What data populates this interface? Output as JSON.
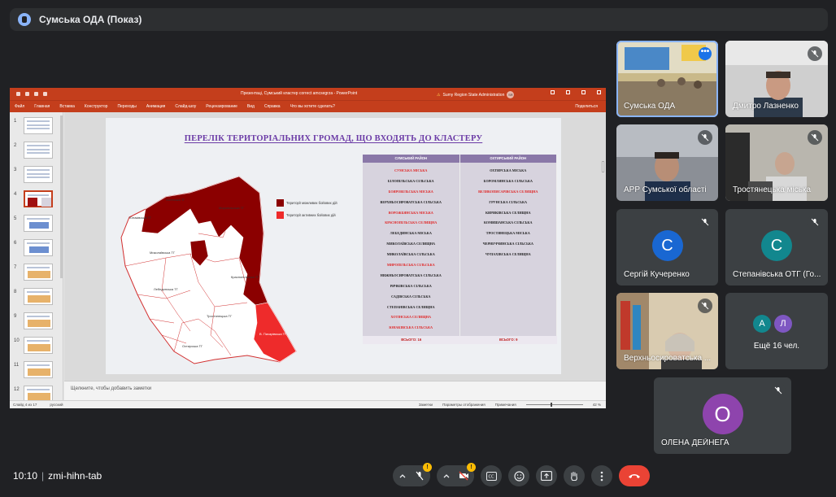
{
  "meeting": {
    "title": "Сумська ОДА (Показ)",
    "time": "10:10",
    "code": "zmi-hihn-tab"
  },
  "ppt": {
    "doc_title": "Презентаці, Сумський кластер correct amcsegrza - PowerPoint",
    "org": "Sumy Region State Administration",
    "user_initials": "SR",
    "ribbon": [
      "Файл",
      "Главная",
      "Вставка",
      "Конструктор",
      "Переходы",
      "Анимация",
      "Слайд-шоу",
      "Рецензирование",
      "Вид",
      "Справка",
      "Что вы хотите сделать?"
    ],
    "share": "Поделиться",
    "notes_placeholder": "Щелкните, чтобы добавить заметки",
    "status": {
      "slide": "Слайд 4 из 17",
      "lang": "русский",
      "notes": "Заметки",
      "display": "Параметры отображения",
      "comments": "Примечания",
      "zoom": "42 %"
    },
    "thumb_numbers": [
      "1",
      "2",
      "3",
      "4",
      "5",
      "6",
      "7",
      "8",
      "9",
      "10",
      "11",
      "12"
    ],
    "active_slide": 4
  },
  "slide": {
    "title": "ПЕРЕЛІК ТЕРИТОРІАЛЬНИХ ГРОМАД, ЩО ВХОДЯТЬ ДО КЛАСТЕРУ",
    "legend": [
      {
        "label": "Території можливих бойових дій",
        "color": "#8b0000"
      },
      {
        "label": "Території активних бойових дій",
        "color": "#ee2b2b"
      }
    ],
    "colors": {
      "possible": "#8b0000",
      "active": "#ee2b2b",
      "header": "#8a78a8"
    },
    "table": {
      "headers": [
        "СУМСЬКИЙ РАЙОН",
        "ОХТИРСЬКИЙ РАЙОН"
      ],
      "sumy": [
        {
          "name": "СУМСЬКА МІСЬКА",
          "red": true
        },
        {
          "name": "БІЛОПІЛЬСЬКА СІЛЬСЬКА",
          "red": false
        },
        {
          "name": "БОЯРОВІЛЬСЬКА МІСЬКА",
          "red": true
        },
        {
          "name": "ВЕРХНЬОСИРОВАТСЬКА СІЛЬСЬКА",
          "red": false
        },
        {
          "name": "ВОРОЖБЯНСЬКА МІСЬКА",
          "red": true
        },
        {
          "name": "КРАСНОПІЛЬСЬКА СЕЛИЩНА",
          "red": true
        },
        {
          "name": "ЛЕБЕДИНСЬКА МІСЬКА",
          "red": false
        },
        {
          "name": "МИКОЛАЇВСЬКА СЕЛИЩНА",
          "red": false
        },
        {
          "name": "МИКОЛАЇВСЬКА СІЛЬСЬКА",
          "red": false
        },
        {
          "name": "МИРОПІЛЬСЬКА СІЛЬСЬКА",
          "red": true
        },
        {
          "name": "НИЖНЬОСИРОВАТСЬКА СІЛЬСЬКА",
          "red": false
        },
        {
          "name": "РЯЧКІВСЬКА СІЛЬСЬКА",
          "red": false
        },
        {
          "name": "САДІВСЬКА СІЛЬСЬКА",
          "red": false
        },
        {
          "name": "СТЕПАНІВСЬКА СЕЛИЩНА",
          "red": false
        },
        {
          "name": "ХОТІНСЬКА СЕЛИЩНА",
          "red": true
        },
        {
          "name": "ЮНАКІВСЬКА СІЛЬСЬКА",
          "red": true
        }
      ],
      "okhtyrka": [
        {
          "name": "ОХТИРСЬКА МІСЬКА",
          "red": false
        },
        {
          "name": "БОРОМЛЯНСЬКА СІЛЬСЬКА",
          "red": false
        },
        {
          "name": "ВЕЛИКОПИСАРІВСЬКА СЕЛИЩНА",
          "red": true
        },
        {
          "name": "ГРУНСЬКА СІЛЬСЬКА",
          "red": false
        },
        {
          "name": "КИРИКІВСЬКА СЕЛИЩНА",
          "red": false
        },
        {
          "name": "КОМИШАНСЬКА СІЛЬСЬКА",
          "red": false
        },
        {
          "name": "ТРОСТЯНЕЦЬКА МІСЬКА",
          "red": false
        },
        {
          "name": "ЧЕРНЕЧЧИНСЬКА СІЛЬСЬКА",
          "red": false
        },
        {
          "name": "ЧУПАХІВСЬКА СЕЛИЩНА",
          "red": false
        }
      ],
      "totals": [
        "ВСЬОГО: 16",
        "ВСЬОГО: 9"
      ]
    }
  },
  "participants": [
    {
      "name": "Сумська ОДА",
      "type": "video",
      "active": true
    },
    {
      "name": "Дмитро Лазненко",
      "type": "video",
      "muted": true
    },
    {
      "name": "АРР Сумської області",
      "type": "video",
      "muted": true
    },
    {
      "name": "Тростянецька міська",
      "type": "video",
      "muted": true
    },
    {
      "name": "Сергій Кучеренко",
      "type": "avatar",
      "letter": "С",
      "color": "#1967d2",
      "muted": true
    },
    {
      "name": "Степанівська ОТГ (Го...",
      "type": "avatar",
      "letter": "С",
      "color": "#12878e",
      "muted": true
    },
    {
      "name": "Верхньосироватська ...",
      "type": "video",
      "muted": true
    },
    {
      "name": "Ещё 16 чел.",
      "type": "more",
      "letters": [
        "А",
        "Л"
      ]
    },
    {
      "name": "ОЛЕНА ДЕЙНЕГА",
      "type": "avatar",
      "letter": "О",
      "color": "#8e44ad",
      "muted": true
    }
  ],
  "controls": {
    "mic_badge": "!",
    "cam_badge": "!"
  }
}
